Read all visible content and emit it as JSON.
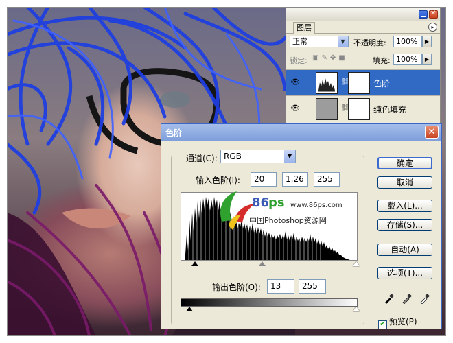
{
  "layers_panel": {
    "tab": "图层",
    "blend_mode": "正常",
    "opacity_label": "不透明度:",
    "opacity_value": "100%",
    "lock_label": "锁定:",
    "fill_label": "填充:",
    "fill_value": "100%",
    "layers": [
      {
        "name": "色阶",
        "selected": true,
        "visible": true,
        "icon": "levels-adjustment-icon"
      },
      {
        "name": "纯色填充",
        "selected": false,
        "visible": true,
        "icon": "solid-fill-icon"
      }
    ]
  },
  "levels_dialog": {
    "title": "色阶",
    "channel_label": "通道(C):",
    "channel_value": "RGB",
    "input_levels_label": "输入色阶(I):",
    "input_black": "20",
    "input_gamma": "1.26",
    "input_white": "255",
    "output_levels_label": "输出色阶(O):",
    "output_black": "13",
    "output_white": "255",
    "buttons": {
      "ok": "确定",
      "cancel": "取消",
      "load": "载入(L)...",
      "save": "存储(S)...",
      "auto": "自动(A)",
      "options": "选项(T)..."
    },
    "preview_label": "预览(P)",
    "preview_checked": true
  },
  "watermark": {
    "number": "86",
    "ps": "ps",
    "url": "www.86ps.com",
    "site": "中国Photoshop资源网"
  },
  "colors": {
    "accent": "#316ac5",
    "dialog_bg": "#ece9d8",
    "hair_blue": "#1f3fe0",
    "hair_purple": "#7a1a6a"
  }
}
